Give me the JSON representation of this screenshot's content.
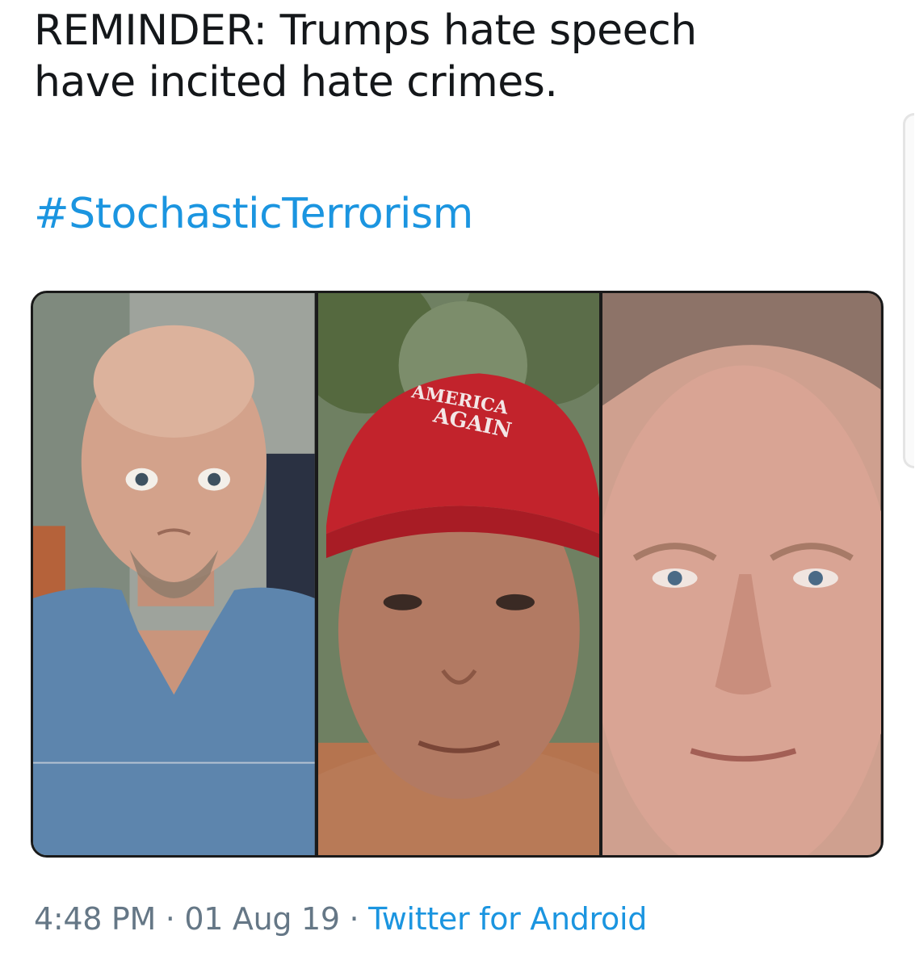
{
  "tweet": {
    "text_line_1": "REMINDER: Trumps hate speech",
    "text_line_2": "have incited hate crimes.",
    "hashtag": "#StochasticTerrorism"
  },
  "media": {
    "photos": [
      {
        "label": "photo-1"
      },
      {
        "label": "photo-2",
        "cap_text_top": "AMERICA",
        "cap_text_bottom": "AGAIN"
      },
      {
        "label": "photo-3"
      }
    ]
  },
  "meta": {
    "time": "4:48 PM",
    "separator": " · ",
    "date": "01 Aug 19",
    "source": "Twitter for Android"
  },
  "colors": {
    "text": "#14171a",
    "link": "#1b95e0",
    "meta": "#657786"
  }
}
